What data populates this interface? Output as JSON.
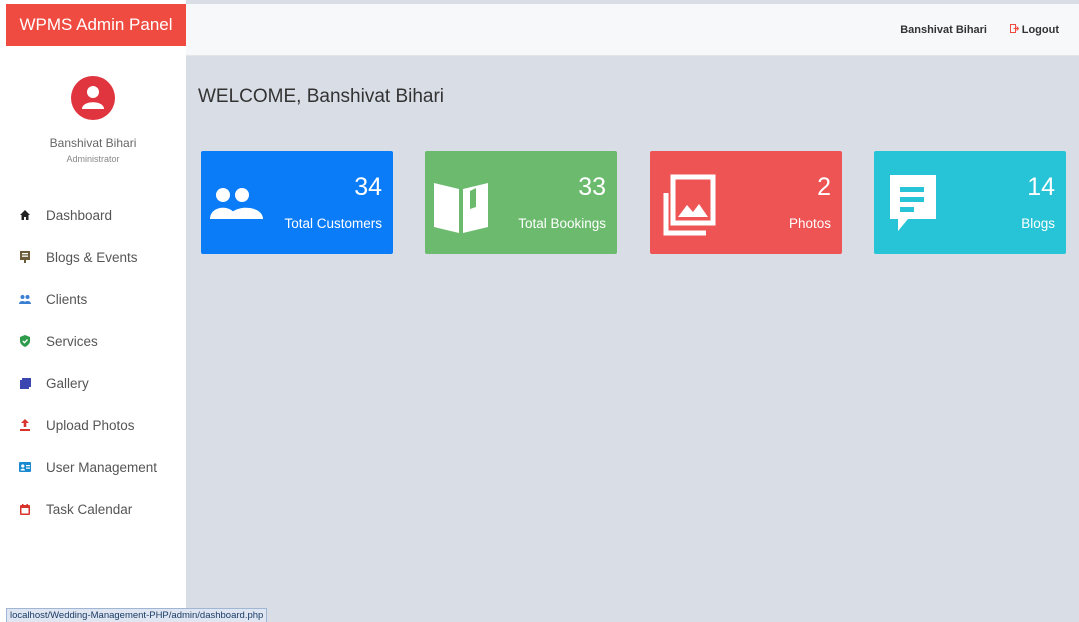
{
  "brand": {
    "title": "WPMS Admin Panel",
    "color": "#ef4b40"
  },
  "profile": {
    "name": "Banshivat Bihari",
    "role": "Administrator"
  },
  "header": {
    "user": "Banshivat Bihari",
    "logout": "Logout"
  },
  "welcome": "WELCOME, Banshivat Bihari",
  "nav": [
    {
      "label": "Dashboard",
      "icon": "home-icon"
    },
    {
      "label": "Blogs & Events",
      "icon": "book-icon"
    },
    {
      "label": "Clients",
      "icon": "users-icon"
    },
    {
      "label": "Services",
      "icon": "shield-icon"
    },
    {
      "label": "Gallery",
      "icon": "gallery-icon"
    },
    {
      "label": "Upload Photos",
      "icon": "upload-icon"
    },
    {
      "label": "User Management",
      "icon": "id-card-icon"
    },
    {
      "label": "Task Calendar",
      "icon": "calendar-icon"
    }
  ],
  "cards": [
    {
      "count": "34",
      "label": "Total Customers",
      "color": "#0b7cf8",
      "icon": "users-icon"
    },
    {
      "count": "33",
      "label": "Total Bookings",
      "color": "#6bba6d",
      "icon": "open-book-icon"
    },
    {
      "count": "2",
      "label": "Photos",
      "color": "#ef5454",
      "icon": "photo-library-icon"
    },
    {
      "count": "14",
      "label": "Blogs",
      "color": "#27c3d6",
      "icon": "comment-icon"
    }
  ],
  "statusbar": {
    "url": "localhost/Wedding-Management-PHP/admin/dashboard.php"
  }
}
